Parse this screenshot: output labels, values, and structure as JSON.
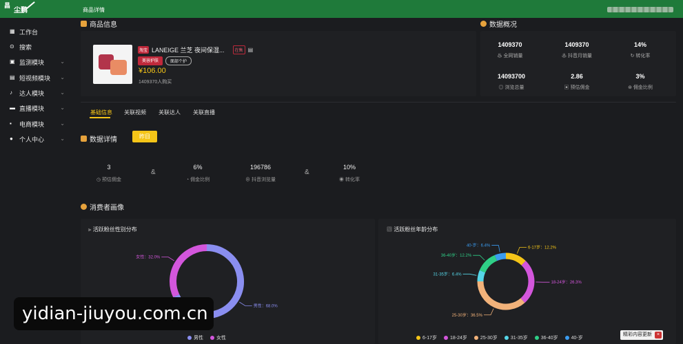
{
  "header": {
    "logo_line1": "昌",
    "logo_line2": "尘鹏",
    "breadcrumb": "商品详情"
  },
  "sidebar": {
    "items": [
      {
        "label": "工作台",
        "icon": "grid-icon"
      },
      {
        "label": "搜索",
        "icon": "search-icon"
      },
      {
        "label": "监测模块",
        "icon": "monitor-icon",
        "chevron": "⌄"
      },
      {
        "label": "短视频模块",
        "icon": "video-icon",
        "chevron": "⌄"
      },
      {
        "label": "达人模块",
        "icon": "person-icon",
        "chevron": "⌄"
      },
      {
        "label": "直播模块",
        "icon": "live-icon",
        "chevron": "⌄"
      },
      {
        "label": "电商模块",
        "icon": "shop-icon",
        "chevron": "⌄"
      },
      {
        "label": "个人中心",
        "icon": "user-icon",
        "chevron": "⌄"
      }
    ]
  },
  "product": {
    "section_title": "商品信息",
    "platform_tag": "淘宝",
    "name": "LANEIGE 兰芝 夜间保湿...",
    "status_tag": "在售",
    "category_tags": [
      "美容护肤",
      "面部个护"
    ],
    "price": "¥106.00",
    "buyers": "1409370人购买"
  },
  "overview": {
    "title": "数据概况",
    "stats": [
      {
        "value": "1409370",
        "label": "全网销量"
      },
      {
        "value": "1409370",
        "label": "抖音月销量"
      },
      {
        "value": "14%",
        "label": "转化率"
      },
      {
        "value": "14093700",
        "label": "浏览总量"
      },
      {
        "value": "2.86",
        "label": "预估佣金"
      },
      {
        "value": "3%",
        "label": "佣金比例"
      }
    ]
  },
  "tabs": [
    "基础信息",
    "关联视频",
    "关联达人",
    "关联直播"
  ],
  "data_detail": {
    "title": "数据详情",
    "button": "昨日",
    "metrics": [
      {
        "value": "3",
        "label": "预估佣金"
      },
      {
        "value": "6%",
        "label": "佣金比例"
      },
      {
        "value": "196786",
        "label": "抖音浏览量"
      },
      {
        "value": "10%",
        "label": "转化率"
      }
    ],
    "amp": "&"
  },
  "consumer": {
    "title": "消费者画像"
  },
  "chart_data": [
    {
      "type": "pie",
      "title": "活跃粉丝性别分布",
      "categories": [
        "男性",
        "女性"
      ],
      "values": [
        68.0,
        32.0
      ],
      "labels": [
        "男性：68.0%",
        "女性：32.0%"
      ],
      "colors": [
        "#8a8ef0",
        "#d356dc"
      ],
      "legend": "bottom"
    },
    {
      "type": "pie",
      "title": "活跃粉丝年龄分布",
      "categories": [
        "6-17岁",
        "18-24岁",
        "25-30岁",
        "31-35岁",
        "36-40岁",
        "40-岁"
      ],
      "values": [
        12.2,
        26.3,
        36.5,
        6.4,
        12.2,
        6.4
      ],
      "labels": [
        "6-17岁：12.2%",
        "18-24岁：26.3%",
        "25-30岁：36.5%",
        "31-35岁：6.4%",
        "36-40岁：12.2%",
        "40-岁：6.4%"
      ],
      "colors": [
        "#f5c518",
        "#d356dc",
        "#f2b27a",
        "#55d6e8",
        "#2fcf87",
        "#3b9cf0"
      ],
      "legend": "bottom"
    }
  ],
  "overlay": {
    "watermark": "yidian-jiuyou.com.cn",
    "update_badge": "精彩内容更新",
    "update_close": "×"
  }
}
